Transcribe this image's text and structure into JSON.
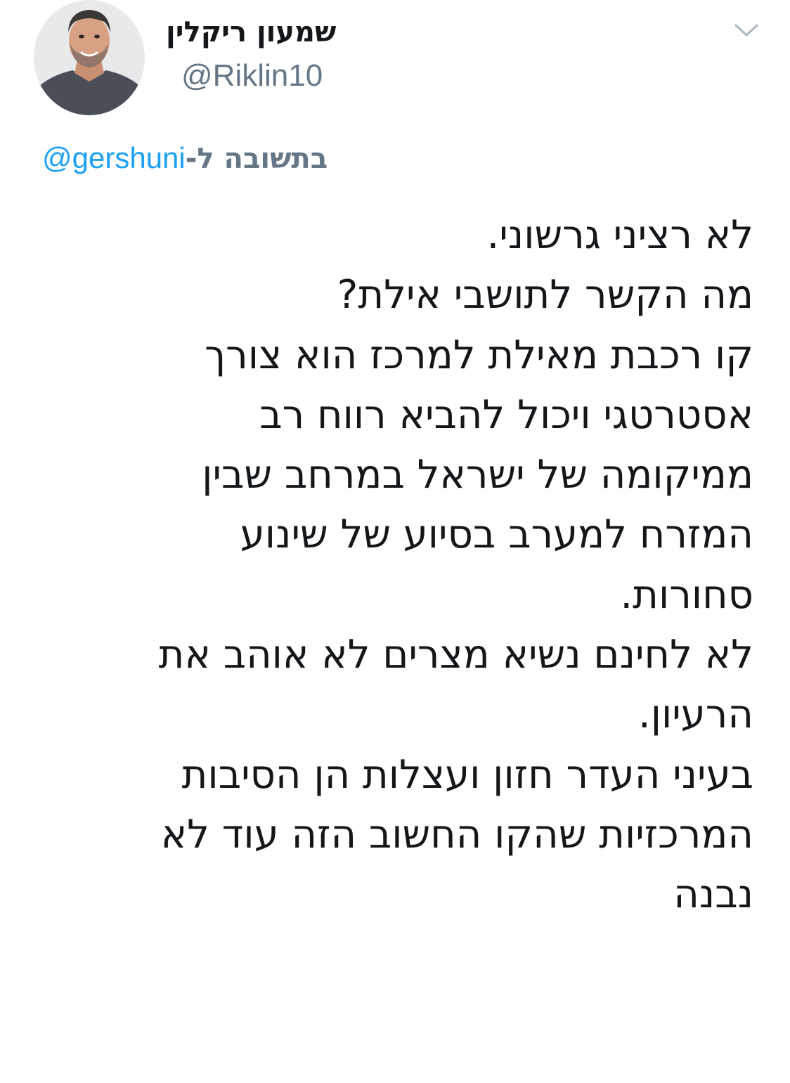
{
  "author": {
    "display_name": "שמעון ריקלין",
    "handle": "@Riklin10",
    "avatar_icon": "profile-photo"
  },
  "menu": {
    "icon": "chevron-down-icon",
    "color": "#aab8c2"
  },
  "reply": {
    "label": "בתשובה ל-",
    "mention": "@gershuni"
  },
  "tweet": {
    "lines": [
      "לא רציני גרשוני.",
      "מה הקשר לתושבי אילת?",
      "קו רכבת מאילת למרכז הוא צורך",
      "אסטרטגי ויכול להביא רווח רב",
      "ממיקומה של ישראל במרחב שבין",
      "המזרח למערב בסיוע של שינוע",
      "סחורות.",
      "לא לחינם נשיא מצרים לא אוהב את",
      "הרעיון.",
      "בעיני העדר חזון ועצלות הן הסיבות",
      "המרכזיות שהקו החשוב הזה עוד לא",
      "נבנה"
    ]
  },
  "colors": {
    "text": "#14171a",
    "secondary": "#657786",
    "link": "#1da1f2"
  }
}
